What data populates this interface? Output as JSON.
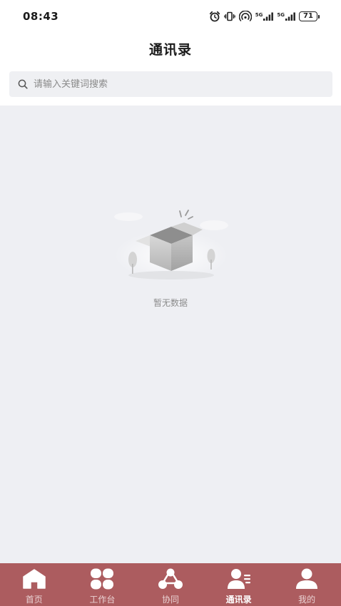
{
  "status_bar": {
    "time": "08:43",
    "signal_1_label": "5G",
    "signal_2_label": "5G",
    "battery_level": "71"
  },
  "header": {
    "title": "通讯录"
  },
  "search": {
    "placeholder": "请输入关键词搜索",
    "value": ""
  },
  "empty_state": {
    "text": "暂无数据",
    "icon": "empty-box-icon"
  },
  "tab_bar": {
    "active_index": 3,
    "tabs": [
      {
        "label": "首页",
        "icon": "home-icon"
      },
      {
        "label": "工作台",
        "icon": "grid-icon"
      },
      {
        "label": "协同",
        "icon": "collaboration-icon"
      },
      {
        "label": "通讯录",
        "icon": "contacts-icon"
      },
      {
        "label": "我的",
        "icon": "user-icon"
      }
    ]
  },
  "colors": {
    "tab_bar_bg": "#ac5c5f",
    "content_bg": "#eeeff3",
    "search_bg": "#eff0f3"
  }
}
